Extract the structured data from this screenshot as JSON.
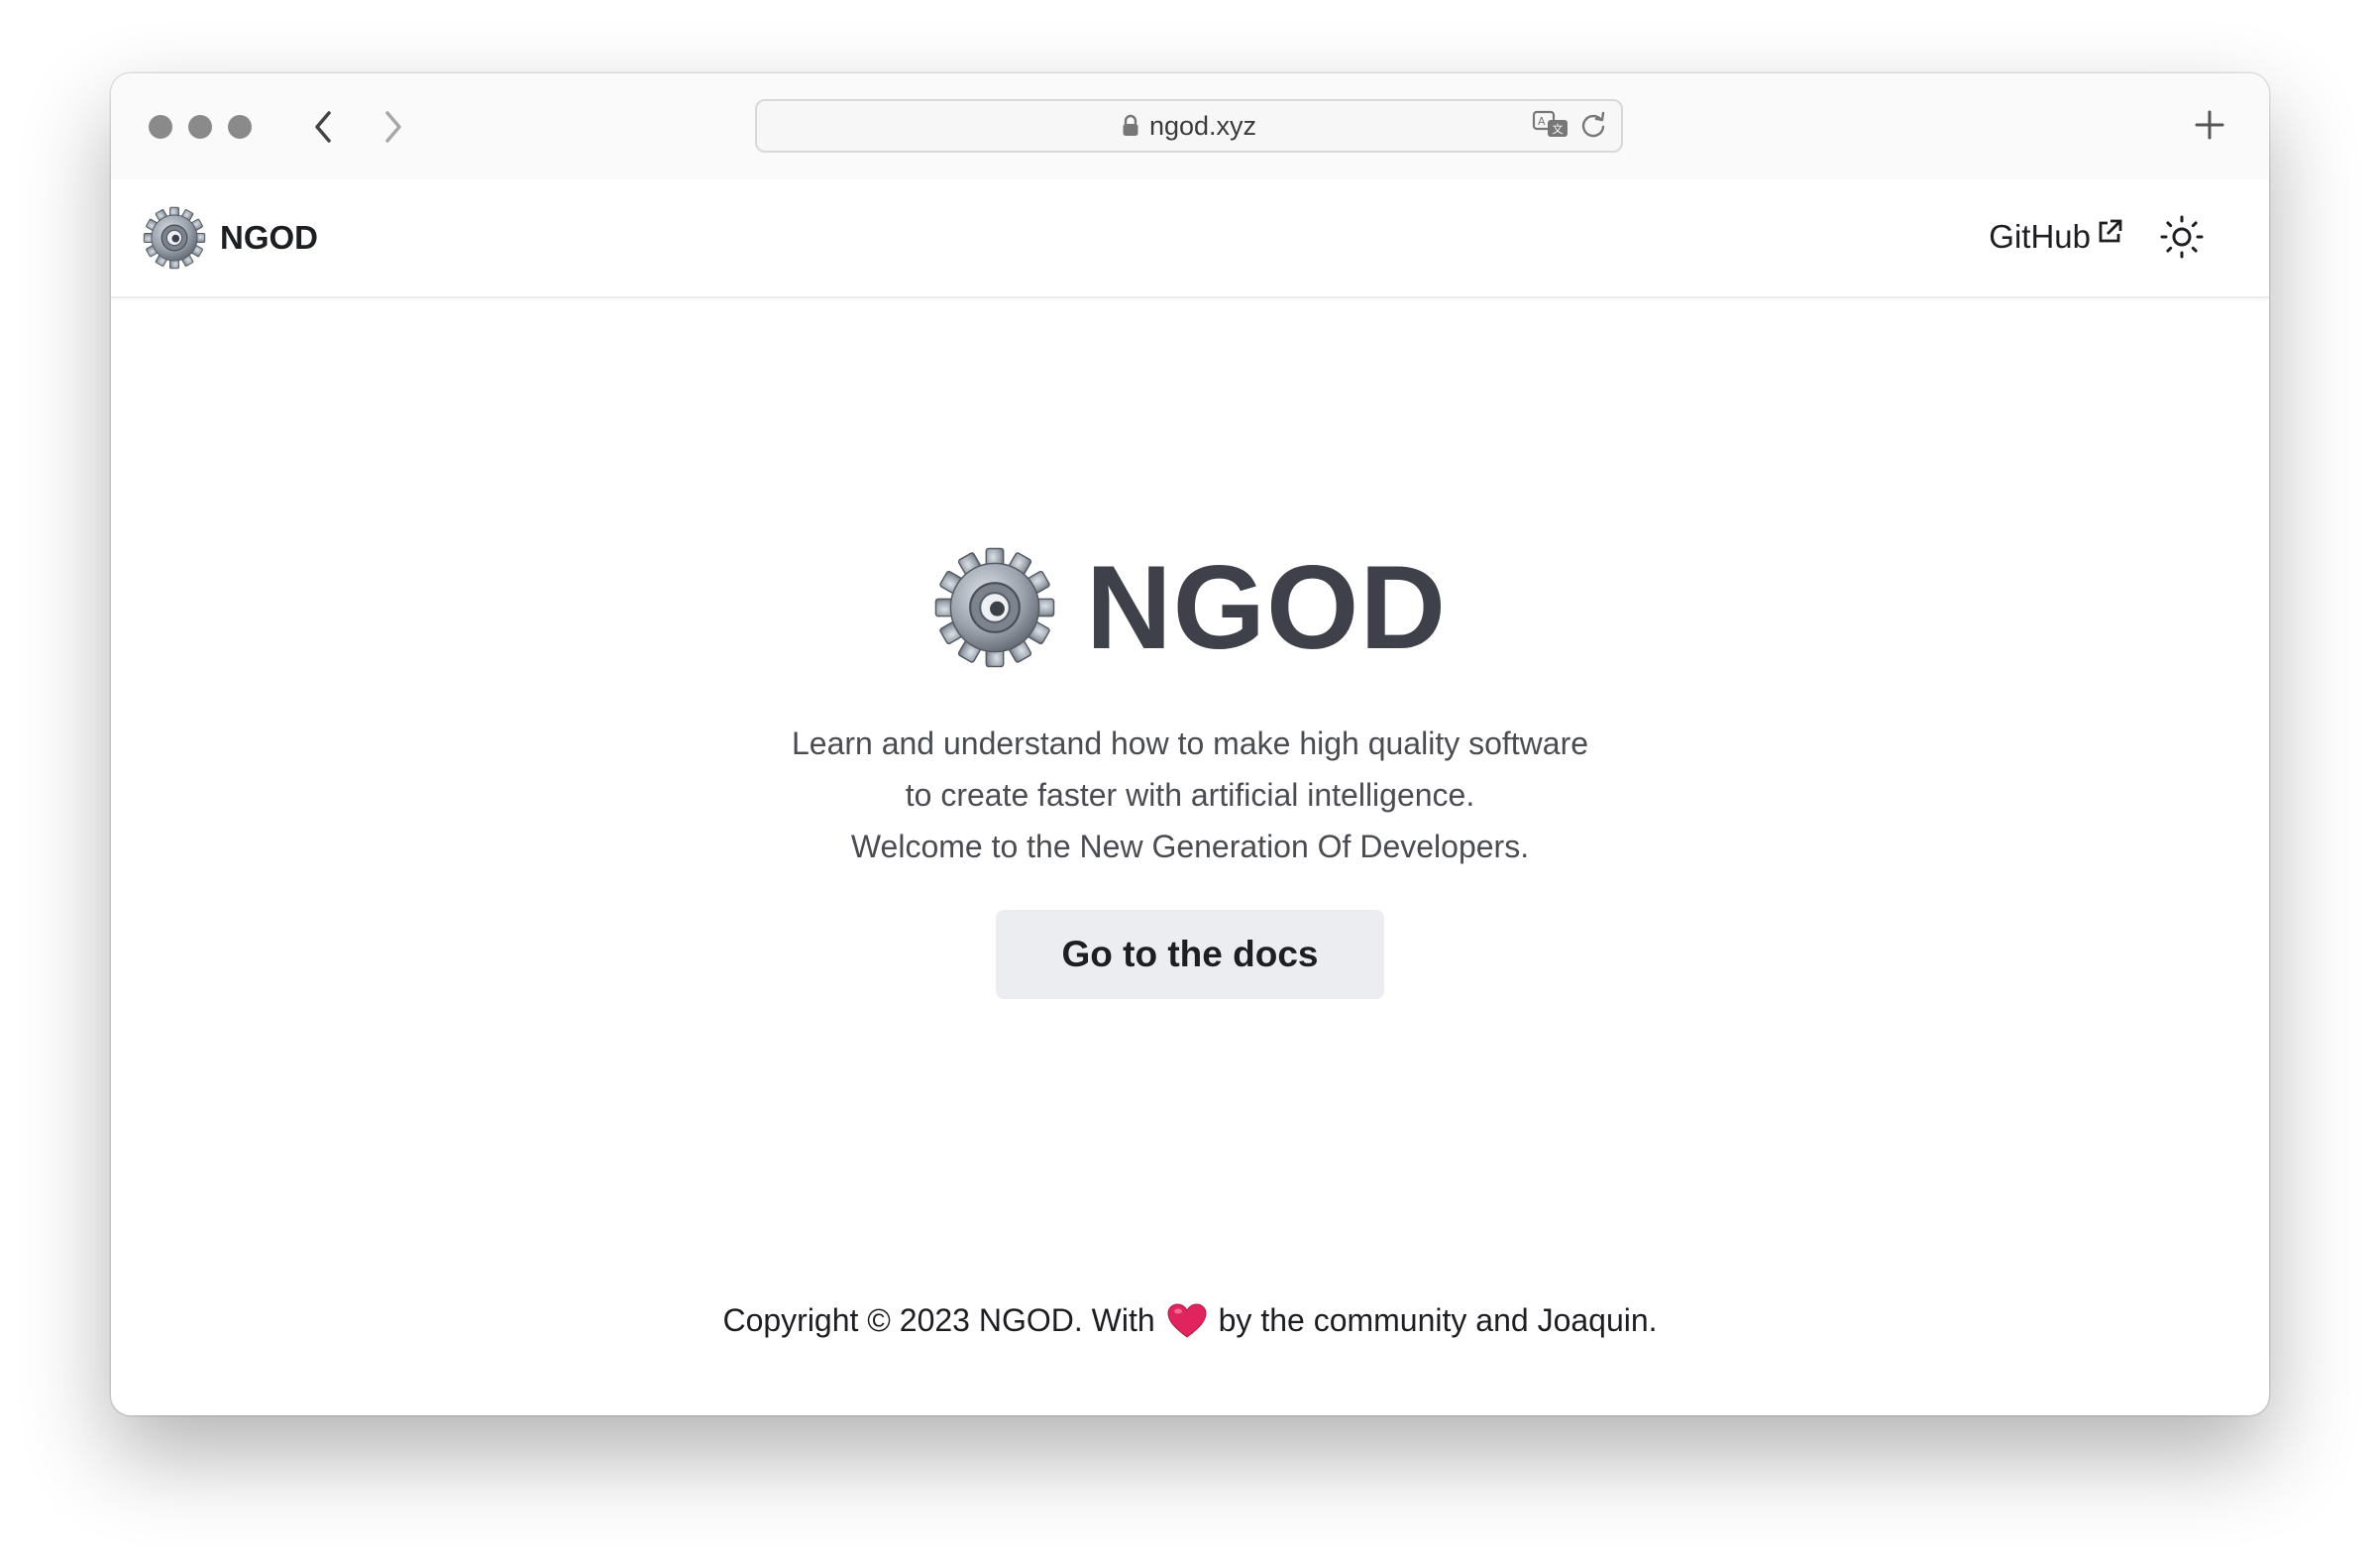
{
  "browser": {
    "url": "ngod.xyz",
    "new_tab_label": "+"
  },
  "navbar": {
    "brand_title": "NGOD",
    "github_label": "GitHub"
  },
  "hero": {
    "title": "NGOD",
    "subtitle_lines": [
      "Learn and understand how to make high quality software",
      "to create faster with artificial intelligence.",
      "Welcome to the New Generation Of Developers."
    ],
    "cta_label": "Go to the docs"
  },
  "footer": {
    "before_heart": "Copyright © 2023 NGOD. With",
    "after_heart": "by the community and Joaquin."
  },
  "colors": {
    "hero_title": "#3e4149",
    "cta_background": "#ebedf0",
    "heart": "#e0245e"
  },
  "icons": [
    "close-dot-icon",
    "minimize-dot-icon",
    "maximize-dot-icon",
    "back-chevron-icon",
    "forward-chevron-icon",
    "lock-icon",
    "translate-icon",
    "reload-icon",
    "plus-icon",
    "gear-logo-icon",
    "external-link-icon",
    "sun-icon",
    "heart-icon"
  ]
}
